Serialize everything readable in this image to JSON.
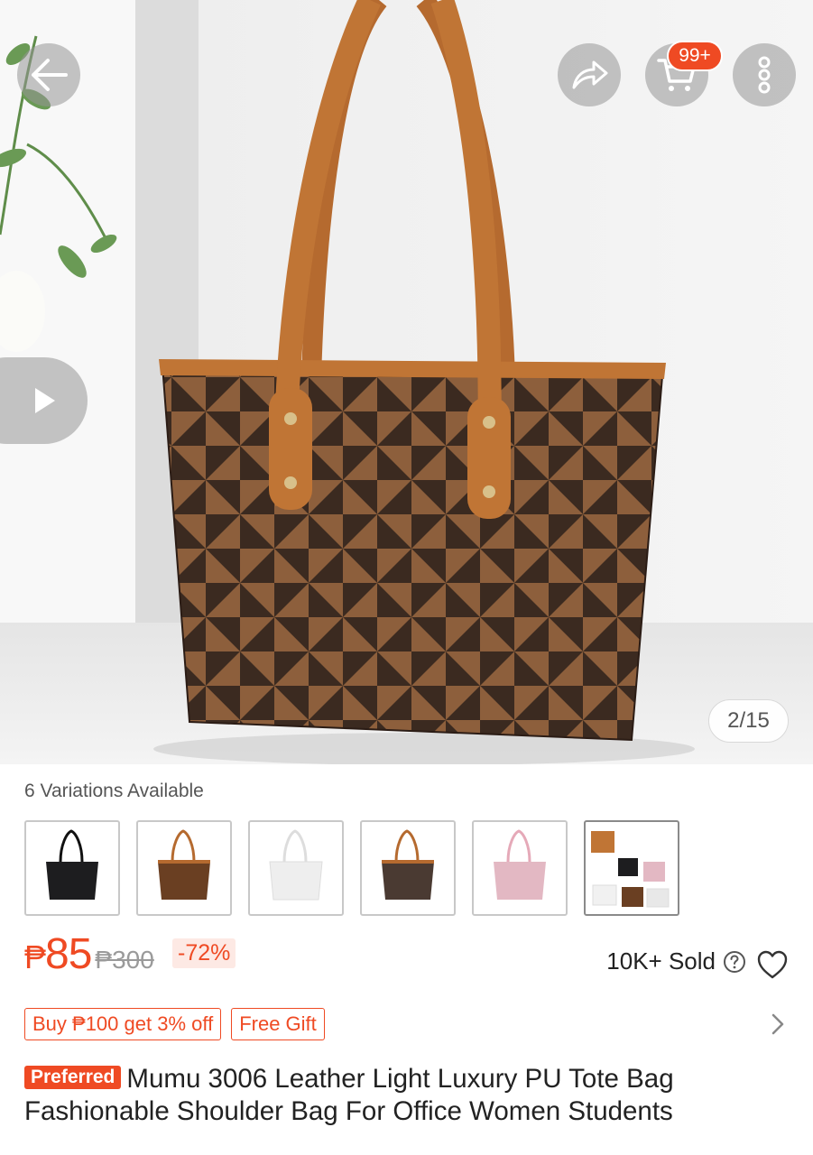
{
  "header": {
    "cart_badge": "99+",
    "icons": [
      "back-arrow-icon",
      "share-icon",
      "cart-icon",
      "more-icon"
    ]
  },
  "gallery": {
    "page_counter": "2/15",
    "play_icon": "play-icon"
  },
  "variations": {
    "label": "6 Variations Available",
    "count": 6,
    "colors": [
      "#1d1d1f",
      "#6a3f22",
      "#f1f1f1",
      "#4a3a32",
      "#e3b8c3",
      "multi"
    ],
    "selected_index": 5
  },
  "pricing": {
    "currency": "₱",
    "price": "85",
    "original_price": "₱300",
    "discount": "-72%",
    "sold": "10K+ Sold"
  },
  "promos": [
    {
      "label": "Buy ₱100 get 3% off"
    },
    {
      "label": "Free Gift"
    }
  ],
  "product": {
    "badge": "Preferred",
    "title": "Mumu 3006 Leather Light Luxury PU Tote Bag Fashionable Shoulder Bag For Office Women Students"
  },
  "colors": {
    "accent": "#ef4a23",
    "bag_dark": "#3d2a20",
    "bag_light": "#8b5d3b",
    "strap": "#b8692f"
  }
}
